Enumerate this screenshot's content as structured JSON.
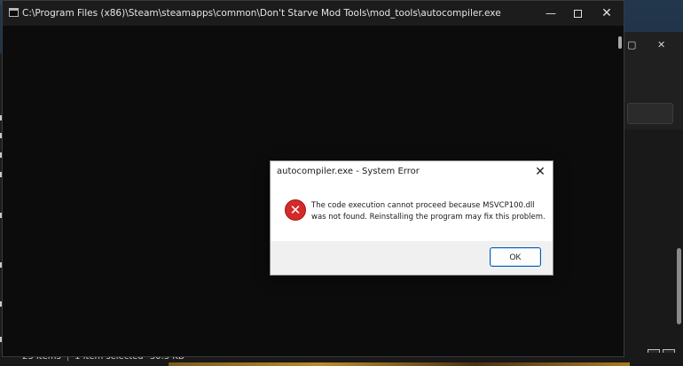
{
  "console": {
    "title": "C:\\Program Files (x86)\\Steam\\steamapps\\common\\Don't Starve Mod Tools\\mod_tools\\autocompiler.exe",
    "minimize_glyph": "—",
    "close_glyph": "✕"
  },
  "dialog": {
    "title": "autocompiler.exe - System Error",
    "close_glyph": "✕",
    "icon_glyph": "✕",
    "message_line1": "The code execution cannot proceed because MSVCP100.dll",
    "message_line2": "was not found. Reinstalling the program may fix this problem.",
    "ok_label": "OK"
  },
  "explorer": {
    "status": {
      "items": "23 items",
      "selected": "1 item selected",
      "size": "30.5 KB"
    }
  },
  "colors": {
    "console_bg": "#0c0c0c",
    "titlebar_bg": "#1c1c1c",
    "error_red": "#d42a2a",
    "ok_border": "#005fb8",
    "dialog_footer": "#f0f0f0"
  },
  "icons": [
    "console-app-icon",
    "minimize-icon",
    "maximize-icon",
    "close-icon",
    "error-icon",
    "dialog-close-icon"
  ]
}
